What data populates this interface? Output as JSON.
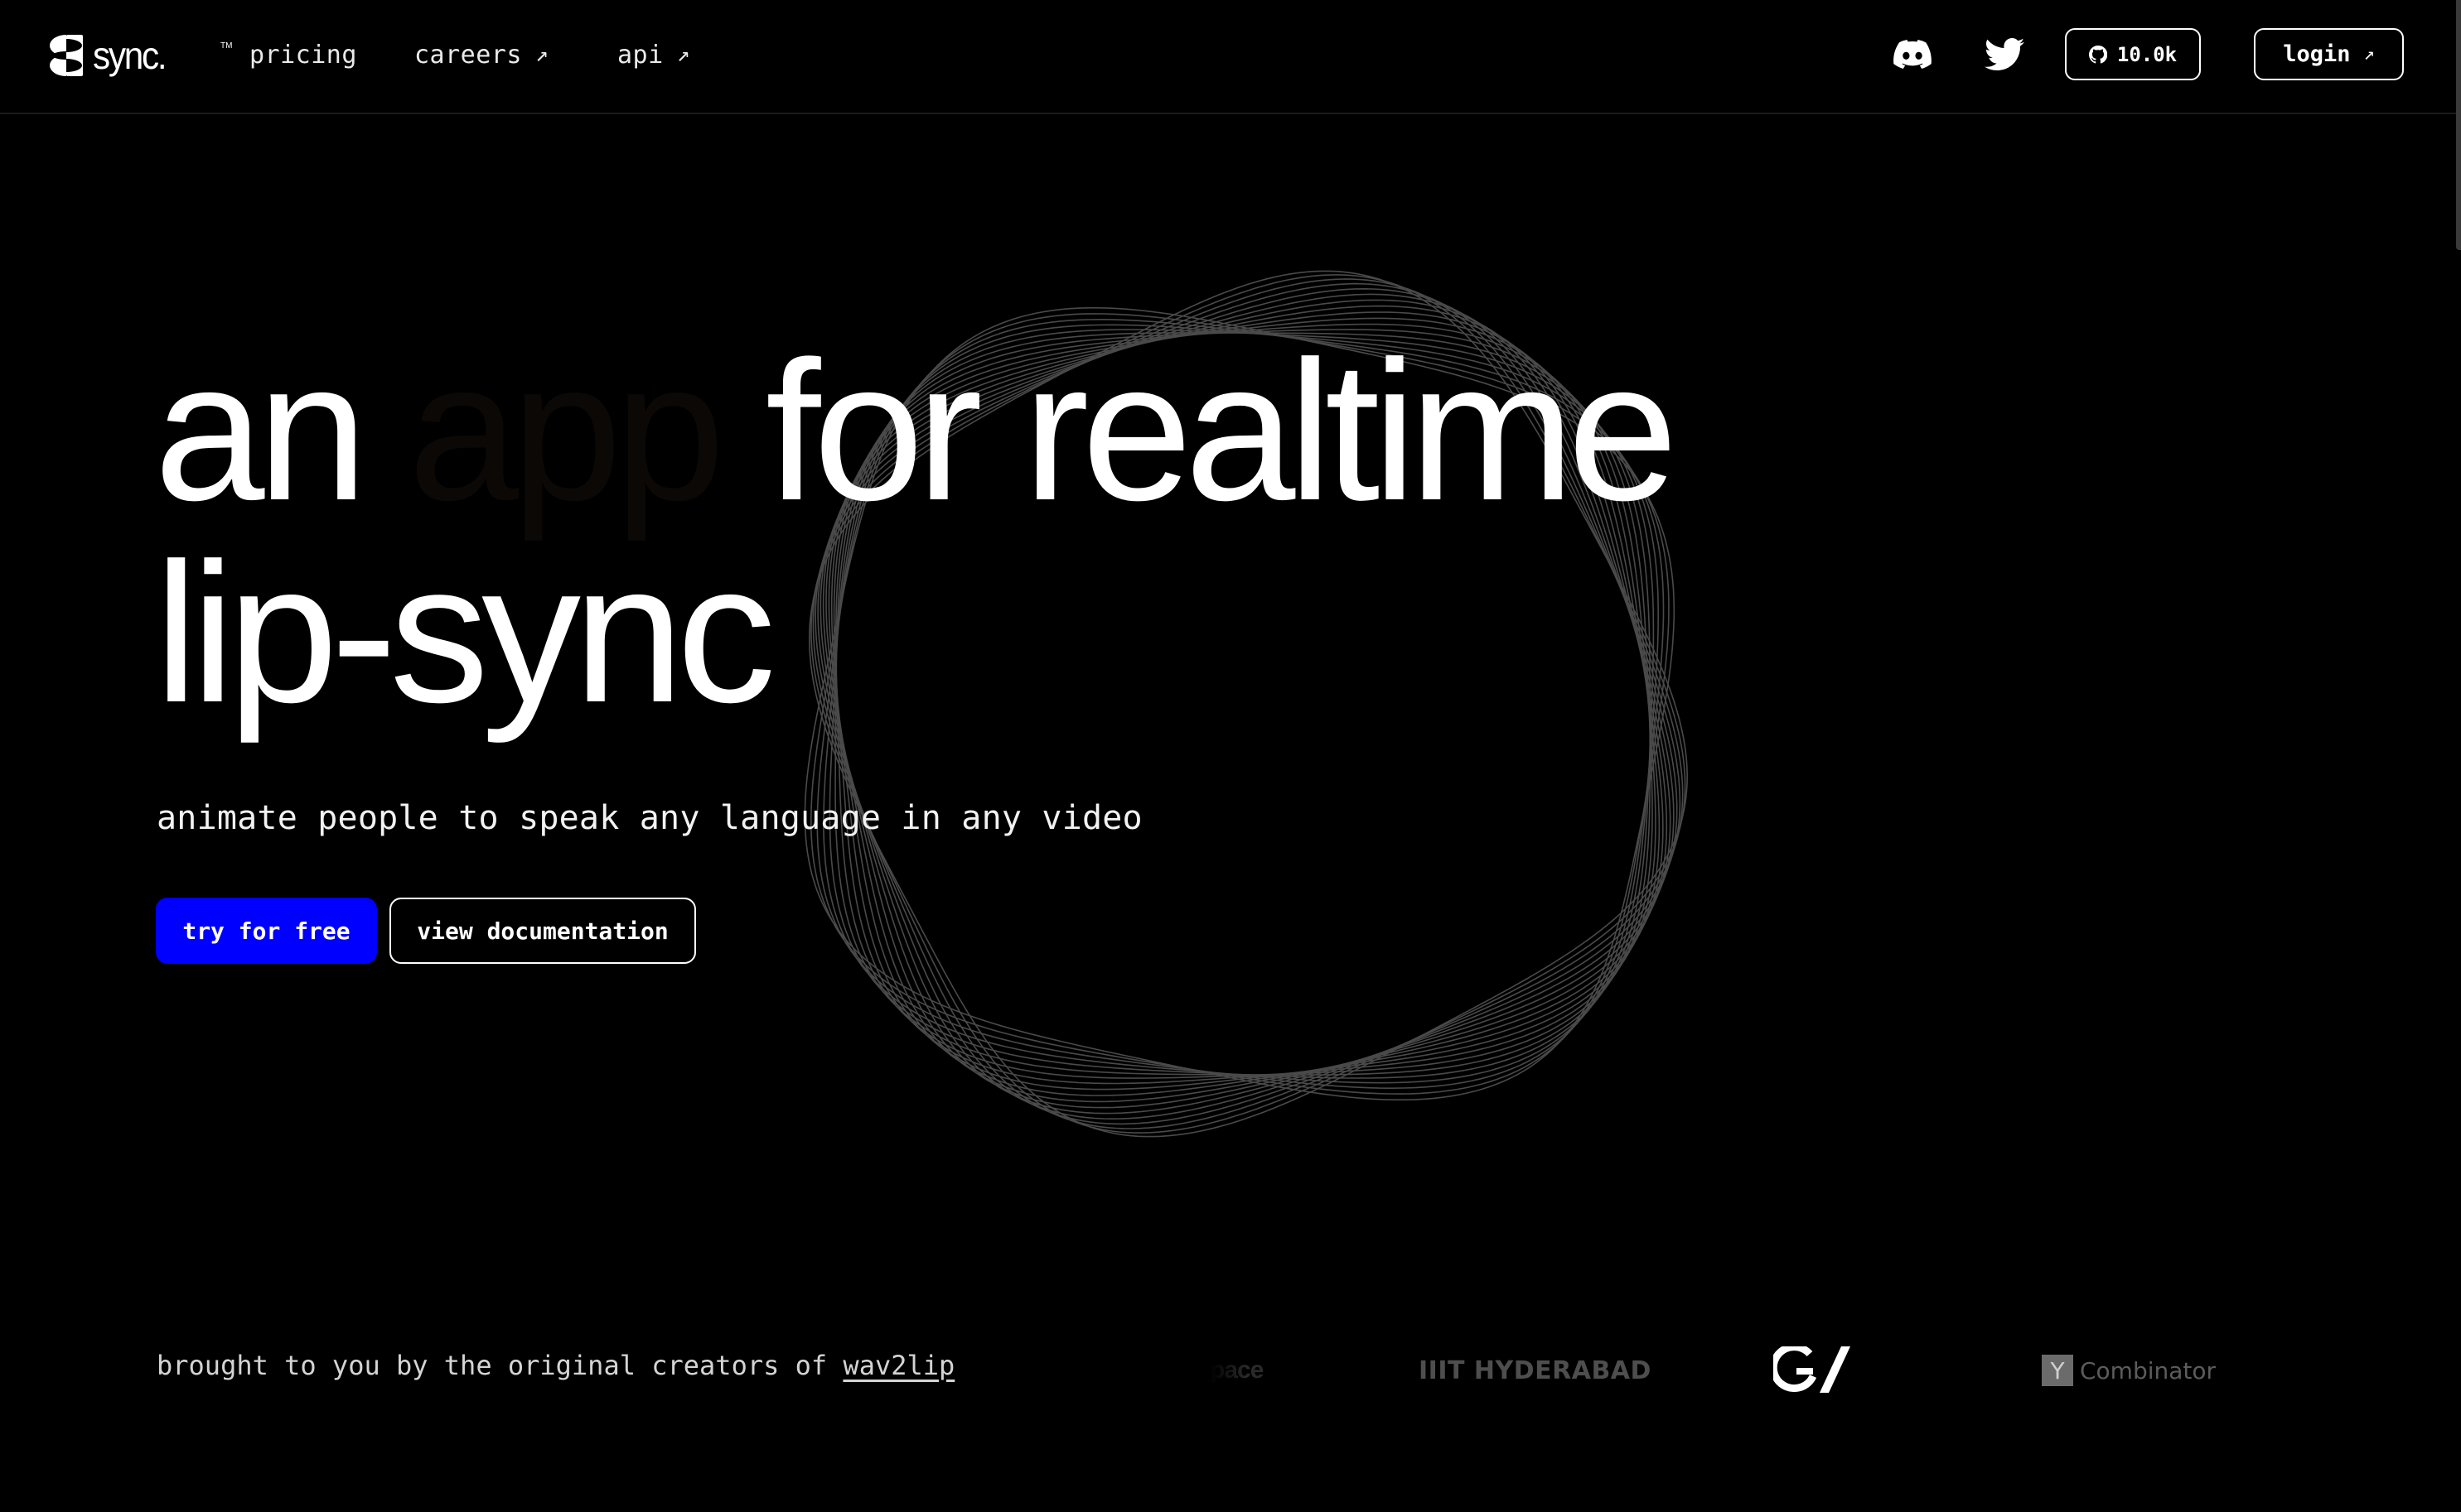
{
  "nav": {
    "brand": "sync.",
    "brand_tm": "TM",
    "links": [
      {
        "label": "pricing",
        "external": false
      },
      {
        "label": "careers",
        "external": true,
        "arrow": "↗"
      },
      {
        "label": "api",
        "external": true,
        "arrow": "↗"
      }
    ],
    "social": [
      {
        "icon": "discord-icon"
      },
      {
        "icon": "twitter-icon"
      }
    ],
    "github": {
      "icon": "github-icon",
      "stars": "10.0k"
    },
    "login": {
      "label": "login",
      "arrow": "↗"
    }
  },
  "hero": {
    "headline": {
      "word1": "an",
      "word2_dim": "app",
      "word3": "for realtime",
      "line2": "lip-sync"
    },
    "subtitle": "animate people to speak any language in any video",
    "primary_cta": "try for free",
    "secondary_cta": "view documentation"
  },
  "credits": {
    "prefix": "brought to you by the original creators of",
    "link": "wav2lip"
  },
  "partners": [
    {
      "name": "pace",
      "faded": true
    },
    {
      "name": "IIIT HYDERABAD"
    },
    {
      "name": "GV"
    },
    {
      "name": "Y Combinator",
      "mark": "Y",
      "word": "Combinator"
    }
  ],
  "colors": {
    "background": "#000000",
    "primary": "#0000ff",
    "text": "#ffffff",
    "dim_word": "#0c0805",
    "swirl_stroke": "#4a4a4a"
  }
}
